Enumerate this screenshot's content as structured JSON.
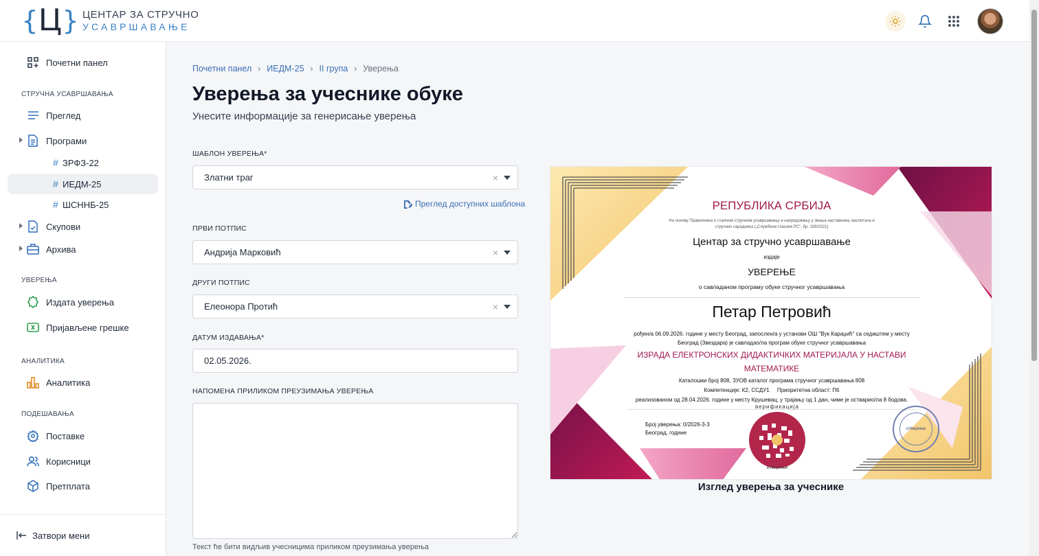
{
  "logo": {
    "line1": "ЦЕНТАР ЗА СТРУЧНО",
    "line2": "УСАВРШАВАЊЕ",
    "mark": "Ц"
  },
  "header_icons": [
    "sun-icon",
    "bell-icon",
    "apps-grid-icon"
  ],
  "sidebar": {
    "dashboard": "Почетни панел",
    "section_training": "СТРУЧНА УСАВРШАВАЊА",
    "overview": "Преглед",
    "programs": "Програми",
    "sub_programs": [
      "ЗРФЗ-22",
      "ИЕДМ-25",
      "ШСННБ-25"
    ],
    "active_sub": "ИЕДМ-25",
    "gatherings": "Скупови",
    "archive": "Архива",
    "section_certs": "УВЕРЕЊА",
    "issued": "Издата уверења",
    "errors": "Пријављене грешке",
    "section_analytics": "АНАЛИТИКА",
    "analytics": "Аналитика",
    "section_settings": "ПОДЕШАВАЊА",
    "settings": "Поставке",
    "users": "Корисници",
    "subscription": "Претплата",
    "close_menu": "Затвори мени"
  },
  "breadcrumb": [
    "Почетни панел",
    "ИЕДМ-25",
    "II група",
    "Уверења"
  ],
  "page": {
    "title": "Уверења за учеснике обуке",
    "subtitle": "Унесите информације за генерисање уверења"
  },
  "form": {
    "template_label": "ШАБЛОН УВЕРЕЊА*",
    "template_value": "Златни траг",
    "template_link": "Преглед доступних шаблона",
    "sign1_label": "ПРВИ ПОТПИС",
    "sign1_value": "Андрија Марковић",
    "sign2_label": "ДРУГИ ПОТПИС",
    "sign2_value": "Елеонора Протић",
    "date_label": "ДАТУМ ИЗДАВАЊА*",
    "date_value": "02.05.2026.",
    "note_label": "НАПОМЕНА ПРИЛИКОМ ПРЕУЗИМАЊА УВЕРЕЊА",
    "note_value": "",
    "note_hint": "Текст ће бити видљив учесницима приликом преузимања уверења",
    "clear_symbol": "×"
  },
  "certificate": {
    "country": "РЕПУБЛИКА СРБИЈА",
    "legal_basis": "На основу Правилника о сталном стручном усавршавању и напредовању у звања наставника, васпитача и стручних сарадника („Службени гласник РС“, бр. 109/2021)",
    "issuer": "Центар за стручно усавршавање",
    "issues": "издаје",
    "doc_type": "УВЕРЕЊЕ",
    "purpose": "о савладаном програму обуке стручног усавршавања",
    "name": "Петар Петровић",
    "line1": "рођен/а 06.09.2026. године у месту Београд, запослен/а у установи ОШ \"Вук Караџић\" са седиштем у месту",
    "line2": "Београд (Звездара) је савладао/ла програм обуке стручног усавршавања",
    "program_title_1": "ИЗРАДА ЕЛЕКТРОНСКИХ ДИДАКТИЧКИХ МАТЕРИЈАЛА У НАСТАВИ",
    "program_title_2": "МАТЕМАТИКЕ",
    "catalog": "Каталошки број 808, ЗУОВ каталог програма стручног усавршавања 808",
    "competences": "Компетенције: К2, ССДУ1     Приоритетна област: П6",
    "realized": "реализованом од 28.04.2026. године у месту Крушевац, у трајању од 1 дан, чиме је остварио/ла 8 бодова.",
    "cert_number": "Број уверења: 0/2026-3-3",
    "place_date": "Београд, године",
    "qr_top": "верификација",
    "qr_bottom": "еУверење",
    "stamp_text": "еУверење",
    "colors": {
      "title": "#a11a4a",
      "magenta": "#a01850",
      "gold": "#f2c46a",
      "pink": "#e07aa8"
    }
  },
  "caption": "Изглед уверења за учеснике"
}
